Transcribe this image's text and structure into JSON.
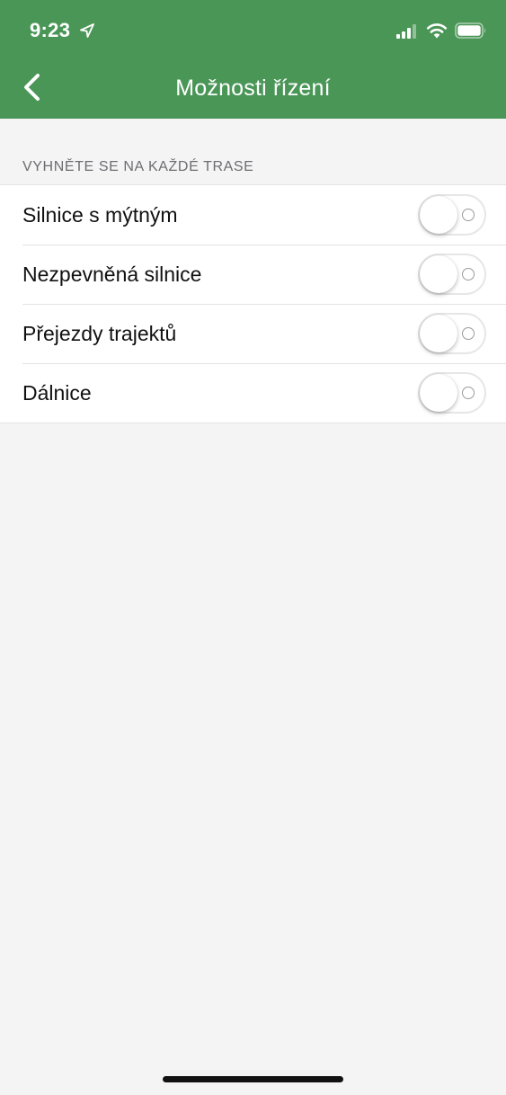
{
  "status_bar": {
    "time": "9:23",
    "icons": [
      "location-arrow-icon",
      "cellular-signal-icon",
      "wifi-icon",
      "battery-icon"
    ]
  },
  "nav": {
    "back_icon": "chevron-left-icon",
    "title": "Možnosti řízení"
  },
  "section": {
    "header": "VYHNĚTE SE NA KAŽDÉ TRASE",
    "items": [
      {
        "label": "Silnice s mýtným",
        "enabled": false
      },
      {
        "label": "Nezpevněná silnice",
        "enabled": false
      },
      {
        "label": "Přejezdy trajektů",
        "enabled": false
      },
      {
        "label": "Dálnice",
        "enabled": false
      }
    ]
  },
  "colors": {
    "brand_green": "#4a9657",
    "background": "#f4f4f4",
    "section_header_text": "#6d6d72"
  }
}
